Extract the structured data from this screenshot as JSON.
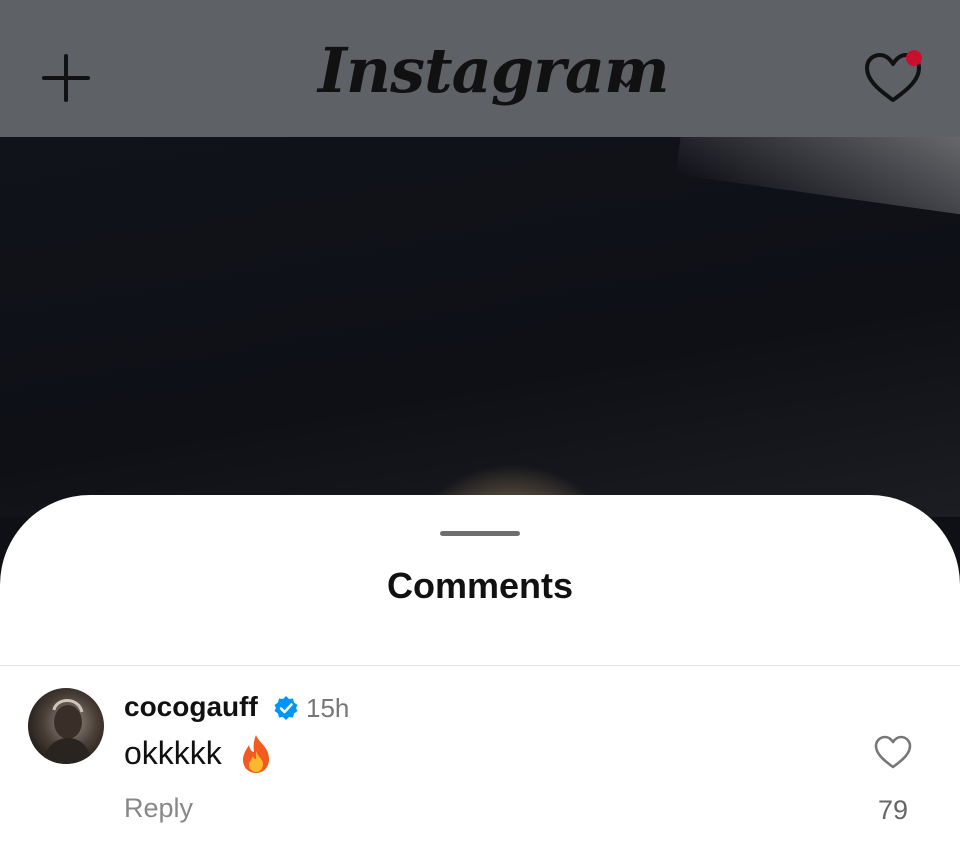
{
  "header": {
    "logo_text": "Instagram",
    "icons": [
      "plus-icon",
      "chevron-down-icon",
      "heart-icon"
    ],
    "notification_dot_color": "#c8102e"
  },
  "sheet": {
    "title": "Comments"
  },
  "comment": {
    "username": "cocogauff",
    "verified": true,
    "time": "15h",
    "text": "okkkkk",
    "emoji": "fire-icon",
    "reply_label": "Reply",
    "like_count": "79"
  },
  "colors": {
    "verified_blue": "#0095f6",
    "text_primary": "#111111",
    "text_secondary": "#888888"
  }
}
